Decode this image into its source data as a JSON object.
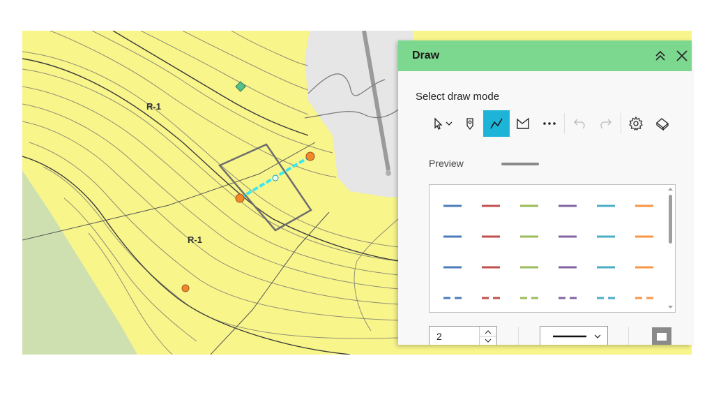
{
  "map": {
    "zone_labels": [
      "R-1",
      "R-1"
    ],
    "colors": {
      "zone_fill": "#f8f58a",
      "contour": "#5a5a5a",
      "gray_area": "#e6e6e6",
      "green_area": "#cfe0b0",
      "sketch_line": "#3fe6ea",
      "vertex": "#f08a24"
    }
  },
  "panel": {
    "title": "Draw",
    "collapse_icon": "double-chevron-up-icon",
    "close_icon": "close-icon",
    "select_mode_label": "Select draw mode",
    "tools": [
      {
        "name": "select-tool",
        "icon": "cursor-icon",
        "active": false
      },
      {
        "name": "point-tool",
        "icon": "map-pin-icon",
        "active": false
      },
      {
        "name": "polyline-tool",
        "icon": "polyline-icon",
        "active": true
      },
      {
        "name": "polygon-tool",
        "icon": "polygon-icon",
        "active": false
      },
      {
        "name": "more-tools",
        "icon": "ellipsis-icon",
        "active": false
      },
      {
        "name": "undo",
        "icon": "undo-icon",
        "active": false
      },
      {
        "name": "redo",
        "icon": "redo-icon",
        "active": false
      },
      {
        "name": "settings",
        "icon": "gear-icon",
        "active": false
      },
      {
        "name": "eraser",
        "icon": "eraser-icon",
        "active": false
      }
    ],
    "preview_label": "Preview",
    "line_colors": [
      "#4a7db8",
      "#c0504d",
      "#9bbb59",
      "#8064a2",
      "#4bacc6",
      "#f79646"
    ],
    "line_width": "2",
    "accent": "#1eb4d8",
    "header_color": "#7dd88f"
  }
}
